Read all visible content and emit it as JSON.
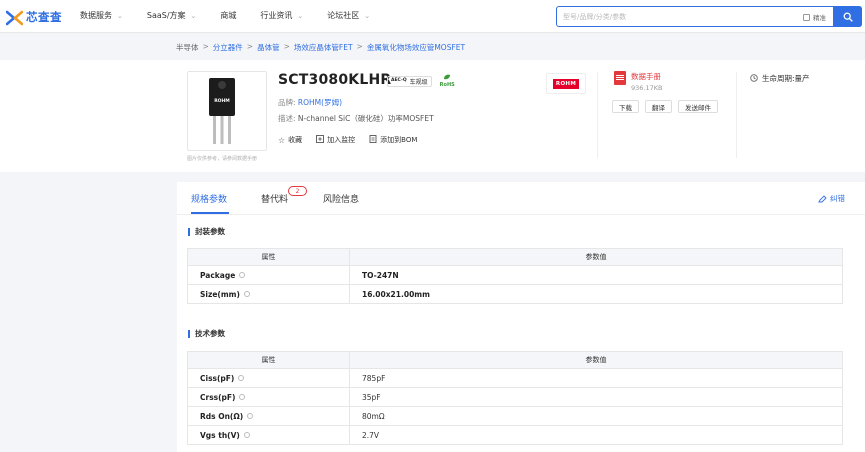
{
  "header": {
    "logo_text": "芯查查",
    "nav": [
      {
        "label": "数据服务",
        "has_dropdown": true
      },
      {
        "label": "SaaS/方案",
        "has_dropdown": true
      },
      {
        "label": "商城",
        "has_dropdown": false
      },
      {
        "label": "行业资讯",
        "has_dropdown": true
      },
      {
        "label": "论坛社区",
        "has_dropdown": true
      }
    ],
    "search": {
      "placeholder": "型号/品牌/分类/参数",
      "value": "",
      "exact_label": "精准",
      "exact_checked": false
    }
  },
  "breadcrumb": {
    "items": [
      "半导体",
      "分立器件",
      "晶体管",
      "场效应晶体管FET",
      "金属氧化物场效应管MOSFET"
    ]
  },
  "product": {
    "part_number": "SCT3080KLHR",
    "aec_badge": {
      "top": "AEC-Q",
      "label": "车规级"
    },
    "rohs_label": "RoHS",
    "package_marking": "ROHM",
    "brand_label": "品牌:",
    "brand_value": "ROHM(罗姆)",
    "desc_label": "描述:",
    "desc_value": "N-channel SiC（碳化硅）功率MOSFET",
    "image_note": "图片仅供参考，请参阅数据手册",
    "actions": [
      {
        "icon": "star-icon",
        "label": "收藏"
      },
      {
        "icon": "monitor-icon",
        "label": "加入监控"
      },
      {
        "icon": "bom-icon",
        "label": "添加到BOM"
      }
    ],
    "brand_logo_text": "ROHM",
    "datasheet": {
      "title": "数据手册",
      "size": "936.17KB",
      "buttons": [
        "下载",
        "翻译",
        "发送邮件"
      ]
    },
    "lifecycle": {
      "label": "生命周期:",
      "value": "量产"
    }
  },
  "tabs": [
    {
      "label": "规格参数",
      "active": true
    },
    {
      "label": "替代料",
      "active": false,
      "badge": "2"
    },
    {
      "label": "风险信息",
      "active": false
    }
  ],
  "correct_label": "纠错",
  "sections": {
    "package": {
      "title": "封装参数",
      "col_attr": "属性",
      "col_value": "参数值",
      "rows": [
        {
          "attr": "Package",
          "value": "TO-247N"
        },
        {
          "attr": "Size(mm)",
          "value": "16.00x21.00mm"
        }
      ]
    },
    "tech": {
      "title": "技术参数",
      "col_attr": "属性",
      "col_value": "参数值",
      "rows": [
        {
          "attr": "Ciss(pF)",
          "value": "785pF"
        },
        {
          "attr": "Crss(pF)",
          "value": "35pF"
        },
        {
          "attr": "Rds On(Ω)",
          "value": "80mΩ"
        },
        {
          "attr": "Vgs th(V)",
          "value": "2.7V"
        }
      ]
    }
  },
  "colors": {
    "accent": "#2f6fe3",
    "alert": "#e4393c",
    "brand_red": "#e4002b",
    "page_bg": "#f4f5f8"
  }
}
